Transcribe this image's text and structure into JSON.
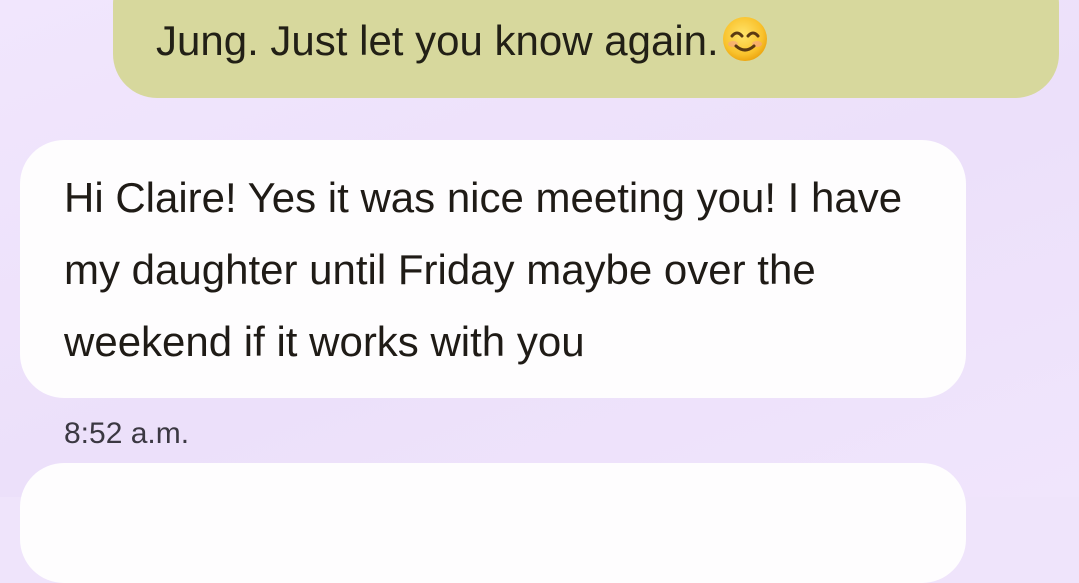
{
  "conversation": {
    "outgoing_message": {
      "text": "Jung. Just let you know again.",
      "emoji_icon": "smiling-face-with-smiling-eyes",
      "bubble_color": "#d7d89d"
    },
    "incoming_message": {
      "text": "Hi Claire! Yes it was nice meeting you! I have my daughter until Friday maybe over the weekend if it works with you",
      "timestamp": "8:52 a.m.",
      "bubble_color": "#fefdfe"
    }
  },
  "theme": {
    "background": "#efe4fb"
  }
}
